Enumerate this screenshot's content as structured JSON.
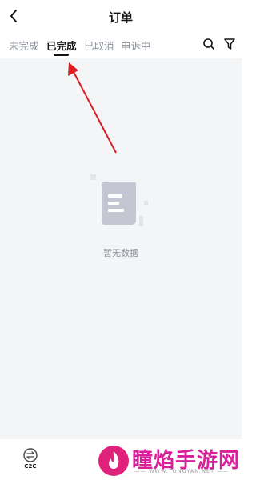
{
  "header": {
    "title": "订单",
    "back_icon": "chevron-left-icon"
  },
  "tabs": [
    {
      "label": "未完成"
    },
    {
      "label": "已完成"
    },
    {
      "label": "已取消"
    },
    {
      "label": "申诉中"
    }
  ],
  "active_tab": 1,
  "toolbar": {
    "search_icon": "search-icon",
    "filter_icon": "filter-icon"
  },
  "empty_state": {
    "text": "暂无数据",
    "illustration": "document-icon"
  },
  "bottom_nav": {
    "c2c_label": "C2C",
    "c2c_icon": "exchange-icon"
  },
  "watermark": {
    "title": "瞳焰手游网",
    "subtitle": "—— WWW.TONGYAN.NET ——"
  },
  "colors": {
    "annotation_arrow": "#d91f26",
    "active_tab": "#111111",
    "inactive_tab": "#8a8f98",
    "content_bg": "#f4f5f7"
  }
}
